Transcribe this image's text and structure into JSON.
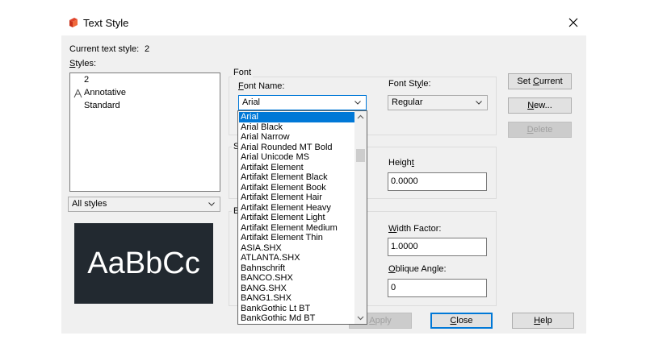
{
  "window": {
    "title": "Text Style"
  },
  "current_style": {
    "label": "Current text style:",
    "value": "2"
  },
  "styles": {
    "label": "Styles:",
    "items": [
      {
        "name": "2",
        "icon": "none"
      },
      {
        "name": "Annotative",
        "icon": "annotative-icon"
      },
      {
        "name": "Standard",
        "icon": "none"
      }
    ],
    "filter": "All styles"
  },
  "preview": {
    "text": "AaBbCc"
  },
  "font": {
    "group_title": "Font",
    "name_label": "Font Name:",
    "name_value": "Arial",
    "style_label": "Font Style:",
    "style_value": "Regular",
    "list": [
      "Arial",
      "Arial Black",
      "Arial Narrow",
      "Arial Rounded MT Bold",
      "Arial Unicode MS",
      "Artifakt Element",
      "Artifakt Element Black",
      "Artifakt Element Book",
      "Artifakt Element Hair",
      "Artifakt Element Heavy",
      "Artifakt Element Light",
      "Artifakt Element Medium",
      "Artifakt Element Thin",
      "ASIA.SHX",
      "ATLANTA.SHX",
      "Bahnschrift",
      "BANCO.SHX",
      "BANG.SHX",
      "BANG1.SHX",
      "BankGothic Lt BT",
      "BankGothic Md BT"
    ],
    "selected_index": 0
  },
  "size": {
    "group_title_partial": "S",
    "height_label": "Height",
    "height_value": "0.0000"
  },
  "effects": {
    "group_title_partial": "E",
    "width_label": "Width Factor:",
    "width_value": "1.0000",
    "oblique_label": "Oblique Angle:",
    "oblique_value": "0"
  },
  "buttons": {
    "set_current": "Set Current",
    "new": "New...",
    "delete": "Delete",
    "apply": "Apply",
    "close": "Close",
    "help": "Help"
  },
  "colors": {
    "accent": "#0078d7",
    "dialog_bg": "#f0f0f0",
    "preview_bg": "#222930"
  }
}
